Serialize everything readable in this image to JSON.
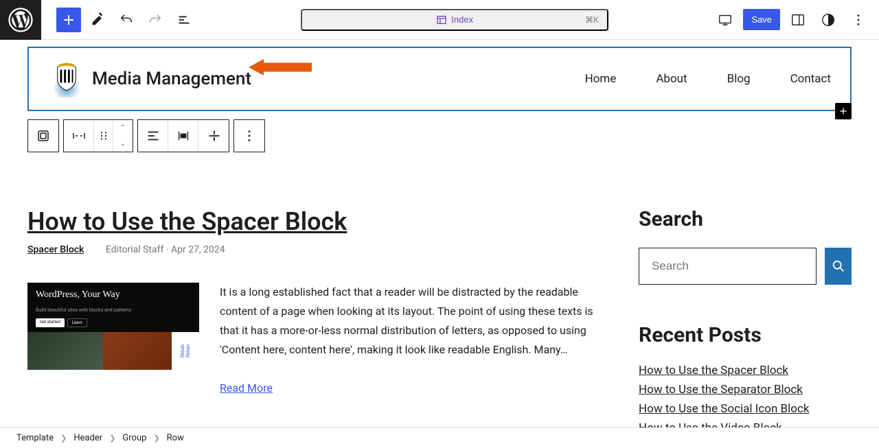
{
  "toolbar": {
    "document_title": "Index",
    "shortcut": "⌘K",
    "save_label": "Save"
  },
  "site": {
    "title": "Media Management",
    "nav": [
      "Home",
      "About",
      "Blog",
      "Contact"
    ]
  },
  "post": {
    "title": "How to Use the Spacer Block",
    "category": "Spacer Block",
    "author": "Editorial Staff",
    "date": "Apr 27, 2024",
    "excerpt": "It is a long established fact that a reader will be distracted by the readable content of a page when looking at its layout. The point of using these texts is that it has a more-or-less normal distribution of letters, as opposed to using 'Content here, content here', making it look like readable English. Many…",
    "read_more": "Read More",
    "featured_headline": "WordPress, Your Way"
  },
  "sidebar": {
    "search_heading": "Search",
    "search_placeholder": "Search",
    "recent_heading": "Recent Posts",
    "recent": [
      "How to Use the Spacer Block",
      "How to Use the Separator Block",
      "How to Use the Social Icon Block",
      "How to Use the Video Block"
    ]
  },
  "breadcrumb": [
    "Template",
    "Header",
    "Group",
    "Row"
  ]
}
